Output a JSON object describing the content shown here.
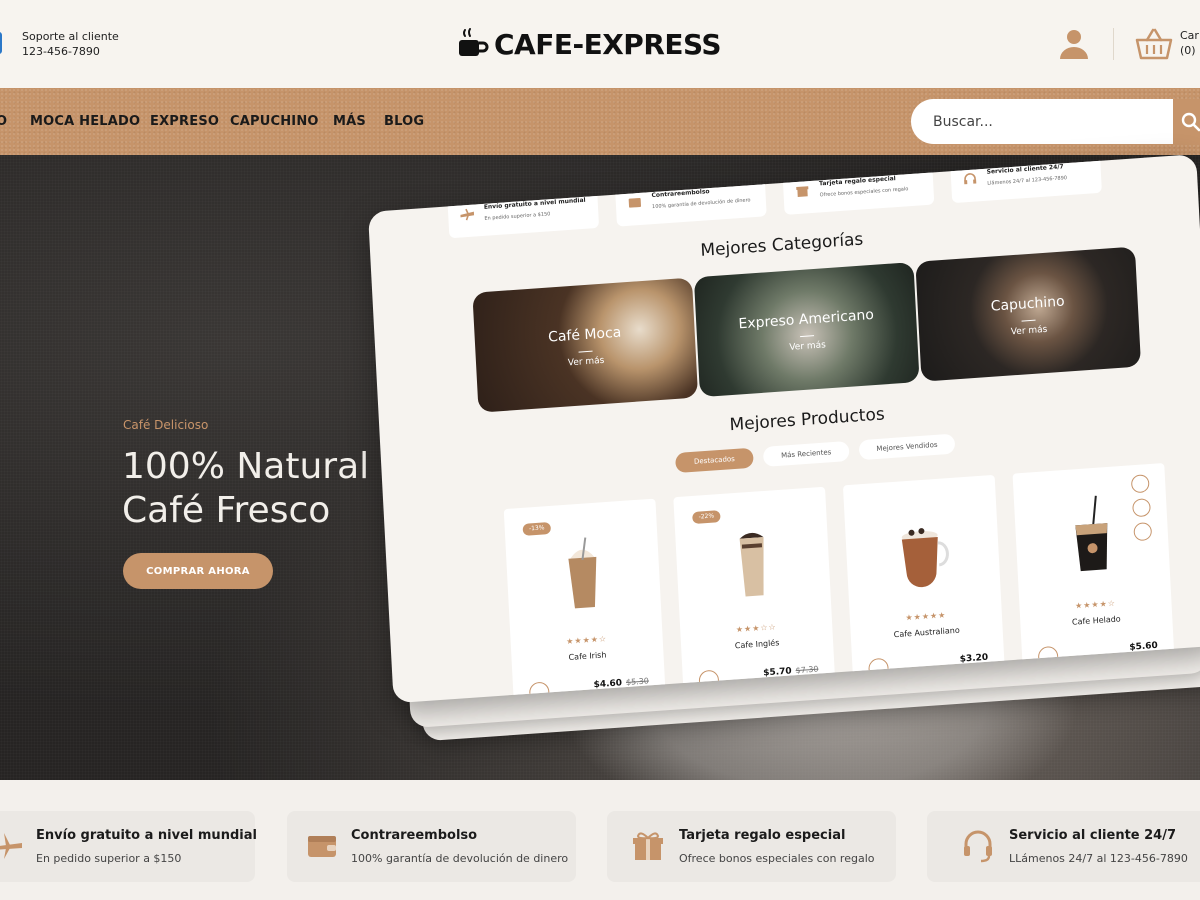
{
  "header": {
    "support_label": "Soporte al cliente",
    "support_phone": "123-456-7890",
    "logo_text": "CAFE-EXPRESS",
    "cart_label": "Car",
    "cart_count": "(0)"
  },
  "nav": {
    "items": [
      {
        "label": "O"
      },
      {
        "label": "MOCA HELADO"
      },
      {
        "label": "EXPRESO"
      },
      {
        "label": "CAPUCHINO"
      },
      {
        "label": "MÁS"
      },
      {
        "label": "BLOG"
      }
    ],
    "search_placeholder": "Buscar..."
  },
  "hero": {
    "eyebrow": "Café Delicioso",
    "title_line1": "100% Natural",
    "title_line2": "Café Fresco",
    "cta": "COMPRAR AHORA"
  },
  "mockup": {
    "features": [
      {
        "title": "Envío gratuito a nivel mundial",
        "sub": "En pedido superior a $150"
      },
      {
        "title": "Contrareembolso",
        "sub": "100% garantía de devolución de dinero"
      },
      {
        "title": "Tarjeta regalo especial",
        "sub": "Ofrece bonos especiales con regalo"
      },
      {
        "title": "Servicio al cliente 24/7",
        "sub": "Llámenos 24/7 al 123-456-7890"
      }
    ],
    "categories_title": "Mejores Categorías",
    "categories": [
      {
        "name": "Café Moca",
        "more": "Ver más"
      },
      {
        "name": "Expreso Americano",
        "more": "Ver más"
      },
      {
        "name": "Capuchino",
        "more": "Ver más"
      }
    ],
    "products_title": "Mejores Productos",
    "tabs": [
      {
        "label": "Destacados",
        "active": true
      },
      {
        "label": "Más Recientes",
        "active": false
      },
      {
        "label": "Mejores Vendidos",
        "active": false
      }
    ],
    "products": [
      {
        "badge": "-13%",
        "name": "Cafe Irish",
        "price": "$4.60",
        "old_price": "$5.30",
        "rating": 4
      },
      {
        "badge": "-22%",
        "name": "Cafe Inglés",
        "price": "$5.70",
        "old_price": "$7.30",
        "rating": 3
      },
      {
        "badge": "",
        "name": "Cafe Australiano",
        "price": "$3.20",
        "old_price": "",
        "rating": 5
      },
      {
        "badge": "",
        "name": "Cafe Helado",
        "price": "$5.60",
        "old_price": "",
        "rating": 4
      }
    ]
  },
  "features": [
    {
      "icon": "airplane-icon",
      "title": "Envío gratuito a nivel mundial",
      "sub": "En pedido superior a $150"
    },
    {
      "icon": "wallet-icon",
      "title": "Contrareembolso",
      "sub": "100% garantía de devolución de dinero"
    },
    {
      "icon": "gift-icon",
      "title": "Tarjeta regalo especial",
      "sub": "Ofrece bonos especiales con regalo"
    },
    {
      "icon": "headset-icon",
      "title": "Servicio al cliente 24/7",
      "sub": "LLámenos 24/7 al 123-456-7890"
    }
  ],
  "colors": {
    "accent": "#c6946a",
    "background": "#f6f3ee",
    "hero_dark": "#2a2827"
  }
}
